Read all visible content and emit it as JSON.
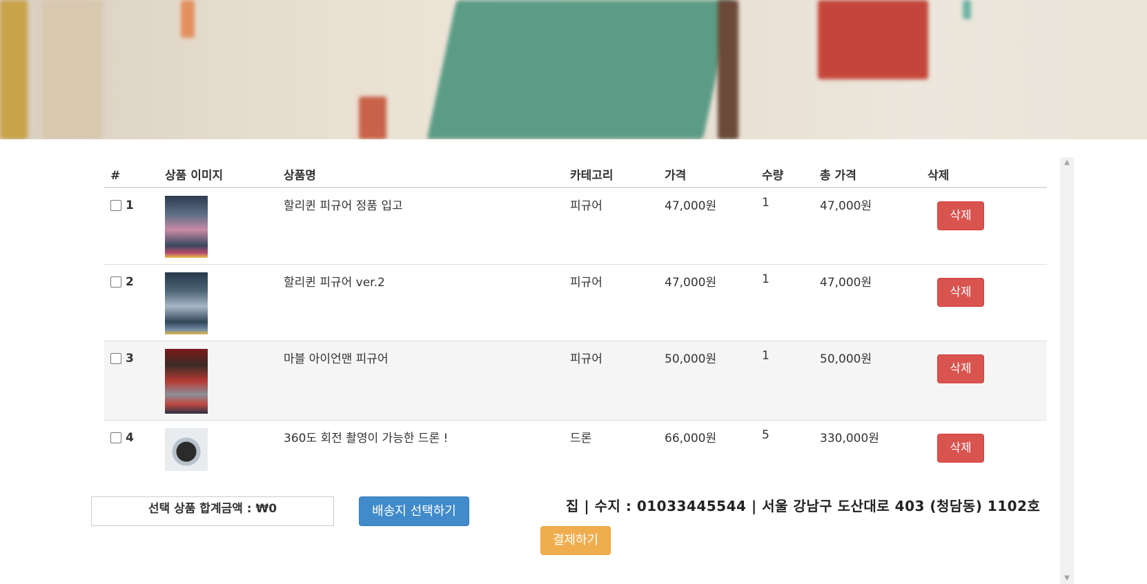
{
  "table": {
    "headers": [
      "#",
      "상품 이미지",
      "상품명",
      "카테고리",
      "가격",
      "수량",
      "총 가격",
      "삭제"
    ],
    "rows": [
      {
        "num": "1",
        "name": "할리퀸 피규어 정품 입고",
        "category": "피규어",
        "price": "47,000원",
        "qty": "1",
        "total": "47,000원",
        "delete_label": "삭제"
      },
      {
        "num": "2",
        "name": "할리퀸 피규어 ver.2",
        "category": "피규어",
        "price": "47,000원",
        "qty": "1",
        "total": "47,000원",
        "delete_label": "삭제"
      },
      {
        "num": "3",
        "name": "마블 아이언맨 피규어",
        "category": "피규어",
        "price": "50,000원",
        "qty": "1",
        "total": "50,000원",
        "delete_label": "삭제"
      },
      {
        "num": "4",
        "name": "360도 회전 촬영이 가능한 드론 !",
        "category": "드론",
        "price": "66,000원",
        "qty": "5",
        "total": "330,000원",
        "delete_label": "삭제"
      }
    ]
  },
  "summary": {
    "selected_total": "선택 상품 합계금액 : ₩0"
  },
  "shipping_button": "배송지 선택하기",
  "address": "집 | 수지 : 01033445544 | 서울 강남구 도산대로 403 (청담동) 1102호",
  "pay_button": "결제하기",
  "colors": {
    "delete": "#d9534f",
    "shipping": "#428bca",
    "pay": "#f0ad4e"
  }
}
